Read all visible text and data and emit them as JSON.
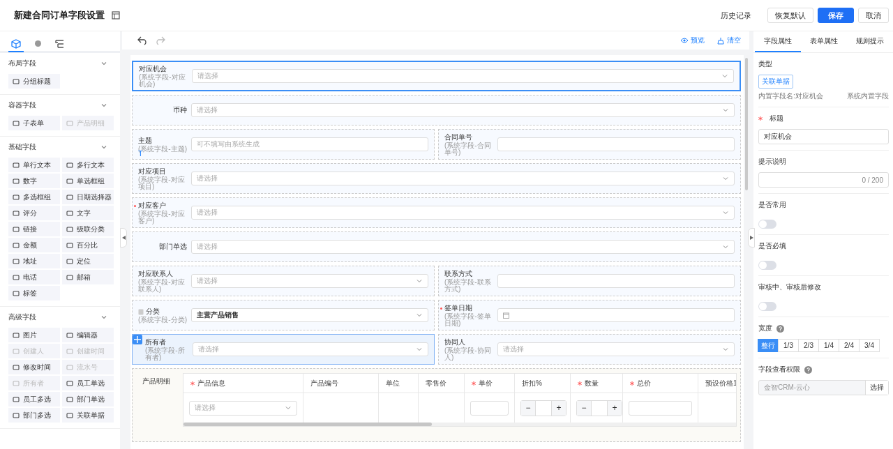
{
  "header": {
    "title": "新建合同订单字段设置",
    "buttons": [
      {
        "label": "历史记录",
        "kind": "link"
      },
      {
        "label": "恢复默认",
        "kind": "default"
      },
      {
        "label": "保存",
        "kind": "primary"
      },
      {
        "label": "取消",
        "kind": "default"
      }
    ]
  },
  "sidebar": {
    "tabs": [
      {
        "selected": true
      },
      {
        "selected": false
      },
      {
        "selected": false
      }
    ],
    "groups": [
      {
        "title": "布局字段",
        "expanded": true,
        "items": [
          {
            "label": "分组标题",
            "disabled": false
          }
        ]
      },
      {
        "title": "容器字段",
        "expanded": true,
        "items": [
          {
            "label": "子表单",
            "disabled": false
          },
          {
            "label": "产品明细",
            "disabled": true
          }
        ]
      },
      {
        "title": "基础字段",
        "expanded": true,
        "items": [
          {
            "label": "单行文本",
            "disabled": false
          },
          {
            "label": "多行文本",
            "disabled": false
          },
          {
            "label": "数字",
            "disabled": false
          },
          {
            "label": "单选框组",
            "disabled": false
          },
          {
            "label": "多选框组",
            "disabled": false
          },
          {
            "label": "日期选择器",
            "disabled": false
          },
          {
            "label": "评分",
            "disabled": false
          },
          {
            "label": "文字",
            "disabled": false
          },
          {
            "label": "链接",
            "disabled": false
          },
          {
            "label": "级联分类",
            "disabled": false
          },
          {
            "label": "金额",
            "disabled": false
          },
          {
            "label": "百分比",
            "disabled": false
          },
          {
            "label": "地址",
            "disabled": false
          },
          {
            "label": "定位",
            "disabled": false
          },
          {
            "label": "电话",
            "disabled": false
          },
          {
            "label": "邮箱",
            "disabled": false
          },
          {
            "label": "标签",
            "disabled": false
          }
        ]
      },
      {
        "title": "高级字段",
        "expanded": true,
        "items": [
          {
            "label": "图片",
            "disabled": false
          },
          {
            "label": "编辑器",
            "disabled": false
          },
          {
            "label": "创建人",
            "disabled": true
          },
          {
            "label": "创建时间",
            "disabled": true
          },
          {
            "label": "修改时间",
            "disabled": false
          },
          {
            "label": "流水号",
            "disabled": true
          },
          {
            "label": "所有者",
            "disabled": true
          },
          {
            "label": "员工单选",
            "disabled": false
          },
          {
            "label": "员工多选",
            "disabled": false
          },
          {
            "label": "部门单选",
            "disabled": false
          },
          {
            "label": "部门多选",
            "disabled": false
          },
          {
            "label": "关联单据",
            "disabled": false
          }
        ]
      }
    ]
  },
  "toolbar": {
    "preview": "预览",
    "clear": "清空"
  },
  "form": {
    "rows": [
      {
        "fields": [
          {
            "label": "对应机会",
            "sub": "(系统字段-对应机会)",
            "required": false,
            "kind": "select",
            "placeholder": "请选择",
            "selected": true,
            "dragging": false
          }
        ]
      },
      {
        "fields": [
          {
            "label": "币种",
            "required": false,
            "kind": "select",
            "placeholder": "请选择",
            "selected": false,
            "dragging": false
          }
        ]
      },
      {
        "fields": [
          {
            "label": "主题",
            "sub": "(系统字段-主题)",
            "required": false,
            "kind": "input",
            "placeholder": "可不填写由系统生成",
            "selected": false,
            "dragging": false,
            "mark": "T"
          },
          {
            "label": "合同单号",
            "sub": "(系统字段-合同单号)",
            "required": false,
            "kind": "input",
            "selected": false,
            "dragging": false
          }
        ]
      },
      {
        "fields": [
          {
            "label": "对应项目",
            "sub": "(系统字段-对应项目)",
            "required": false,
            "kind": "select",
            "placeholder": "请选择",
            "selected": false,
            "dragging": false
          }
        ]
      },
      {
        "fields": [
          {
            "label": "对应客户",
            "sub": "(系统字段-对应客户)",
            "required": true,
            "kind": "select",
            "placeholder": "请选择",
            "selected": false,
            "dragging": false
          }
        ]
      },
      {
        "fields": [
          {
            "label": "部门单选",
            "required": false,
            "kind": "select",
            "placeholder": "请选择",
            "selected": false,
            "dragging": false
          }
        ]
      },
      {
        "fields": [
          {
            "label": "对应联系人",
            "sub": "(系统字段-对应联系人)",
            "required": false,
            "kind": "select",
            "placeholder": "请选择",
            "selected": false,
            "dragging": false
          },
          {
            "label": "联系方式",
            "sub": "(系统字段-联系方式)",
            "required": false,
            "kind": "input",
            "selected": false,
            "dragging": false
          }
        ]
      },
      {
        "fields": [
          {
            "label": "分类",
            "sub": "(系统字段-分类)",
            "required": false,
            "kind": "select",
            "value": "主营产品销售",
            "selected": false,
            "dragging": false,
            "locked": true
          },
          {
            "label": "签单日期",
            "sub": "(系统字段-签单日期)",
            "required": true,
            "kind": "date",
            "selected": false,
            "dragging": false
          }
        ]
      },
      {
        "fields": [
          {
            "label": "所有者",
            "sub": "(系统字段-所有者)",
            "required": false,
            "kind": "select",
            "placeholder": "请选择",
            "selected": false,
            "dragging": true
          },
          {
            "label": "协同人",
            "sub": "(系统字段-协同人)",
            "required": false,
            "kind": "select",
            "placeholder": "请选择",
            "selected": false,
            "dragging": false
          }
        ]
      }
    ],
    "table": {
      "label": "产品明细",
      "columns": [
        {
          "label": "产品信息",
          "required": true
        },
        {
          "label": "产品编号",
          "required": false
        },
        {
          "label": "单位",
          "required": false
        },
        {
          "label": "零售价",
          "required": false
        },
        {
          "label": "单价",
          "required": true
        },
        {
          "label": "折扣%",
          "required": false
        },
        {
          "label": "数量",
          "required": true
        },
        {
          "label": "总价",
          "required": true
        },
        {
          "label": "预设价格1",
          "required": false
        }
      ],
      "cells": [
        {
          "kind": "select",
          "placeholder": "请选择"
        },
        {
          "kind": "empty"
        },
        {
          "kind": "empty"
        },
        {
          "kind": "empty"
        },
        {
          "kind": "input"
        },
        {
          "kind": "stepper",
          "minus": "−",
          "plus": "+"
        },
        {
          "kind": "stepper",
          "minus": "−",
          "plus": "+"
        },
        {
          "kind": "input"
        },
        {
          "kind": "empty"
        }
      ]
    }
  },
  "panel": {
    "tabs": [
      {
        "label": "字段属性",
        "selected": true
      },
      {
        "label": "表单属性",
        "selected": false
      },
      {
        "label": "规则提示",
        "selected": false
      }
    ],
    "type": {
      "label": "类型",
      "tag": "关联单据",
      "name_note": "内置字段名:对应机会",
      "system_note": "系统内置字段"
    },
    "title": {
      "label": "标题",
      "required": true,
      "value": "对应机会"
    },
    "hint": {
      "label": "提示说明",
      "counter": "0 / 200"
    },
    "switches": [
      {
        "label": "是否常用",
        "on": false
      },
      {
        "label": "是否必填",
        "on": false
      },
      {
        "label": "审核中、审核后修改",
        "on": false
      }
    ],
    "width": {
      "label": "宽度",
      "options": [
        {
          "label": "整行",
          "selected": true
        },
        {
          "label": "1/3",
          "selected": false
        },
        {
          "label": "2/3",
          "selected": false
        },
        {
          "label": "1/4",
          "selected": false
        },
        {
          "label": "2/4",
          "selected": false
        },
        {
          "label": "3/4",
          "selected": false
        }
      ]
    },
    "permission": {
      "label": "字段查看权限",
      "value": "金智CRM-云心",
      "disabled": true,
      "button": "选择"
    }
  }
}
